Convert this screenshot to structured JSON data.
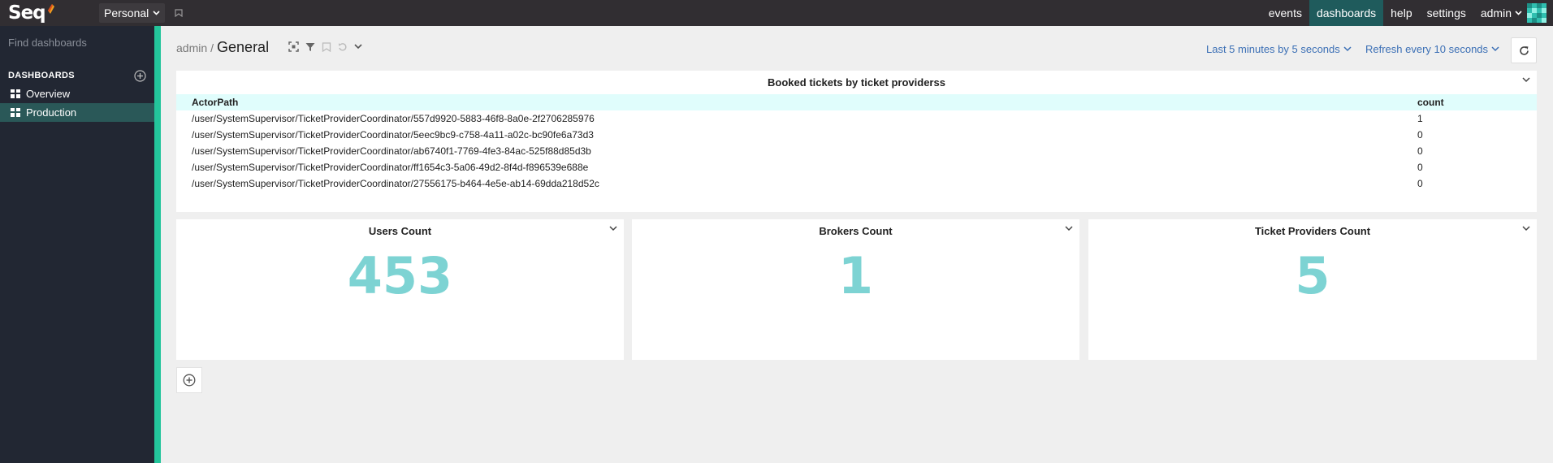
{
  "app": {
    "logo": "Seq",
    "workspace": "Personal"
  },
  "nav": {
    "items": [
      {
        "label": "events"
      },
      {
        "label": "dashboards"
      },
      {
        "label": "help"
      },
      {
        "label": "settings"
      }
    ],
    "active": "dashboards",
    "user": "admin"
  },
  "sidebar": {
    "search_placeholder": "Find dashboards",
    "header": "DASHBOARDS",
    "items": [
      {
        "label": "Overview",
        "active": false
      },
      {
        "label": "Production",
        "active": true
      }
    ]
  },
  "toolbar": {
    "owner": "admin",
    "separator": "/",
    "title": "General",
    "range": "Last 5 minutes by 5 seconds",
    "refresh": "Refresh every 10 seconds"
  },
  "table_card": {
    "title": "Booked tickets by ticket providerss",
    "columns": [
      "ActorPath",
      "count"
    ],
    "rows": [
      [
        "/user/SystemSupervisor/TicketProviderCoordinator/557d9920-5883-46f8-8a0e-2f2706285976",
        "1"
      ],
      [
        "/user/SystemSupervisor/TicketProviderCoordinator/5eec9bc9-c758-4a11-a02c-bc90fe6a73d3",
        "0"
      ],
      [
        "/user/SystemSupervisor/TicketProviderCoordinator/ab6740f1-7769-4fe3-84ac-525f88d85d3b",
        "0"
      ],
      [
        "/user/SystemSupervisor/TicketProviderCoordinator/ff1654c3-5a06-49d2-8f4d-f896539e688e",
        "0"
      ],
      [
        "/user/SystemSupervisor/TicketProviderCoordinator/27556175-b464-4e5e-ab14-69dda218d52c",
        "0"
      ]
    ]
  },
  "metrics": [
    {
      "title": "Users Count",
      "value": "453"
    },
    {
      "title": "Brokers Count",
      "value": "1"
    },
    {
      "title": "Ticket Providers Count",
      "value": "5"
    }
  ],
  "colors": {
    "topbar": "#312e32",
    "sidebar": "#222733",
    "accent_green": "#23c59b",
    "metric_value": "#7dd3d3",
    "link_blue": "#3b6fb5",
    "table_header": "#e0fdfc"
  }
}
